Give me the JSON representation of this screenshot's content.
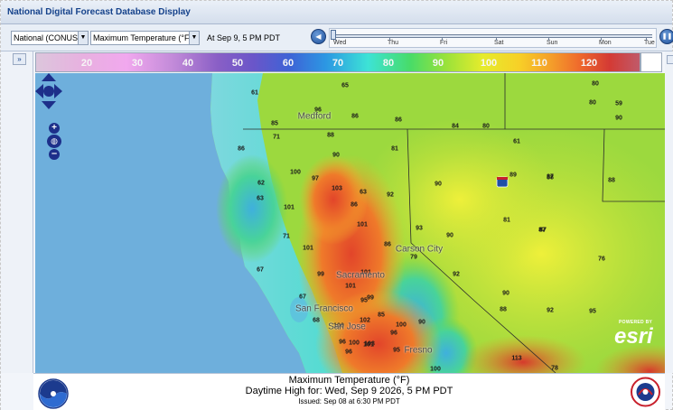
{
  "window": {
    "title": "National Digital Forecast Database Display"
  },
  "toolbar": {
    "region_select": "National (CONUS",
    "element_select": "Maximum Temperature (°F",
    "valid_time": "At Sep  9,   5 PM PDT",
    "timeline_days": [
      "Wed",
      "Thu",
      "Fri",
      "Sat",
      "Sun",
      "Mon",
      "Tue"
    ]
  },
  "legend": {
    "labels": [
      "20",
      "30",
      "40",
      "50",
      "60",
      "70",
      "80",
      "90",
      "100",
      "110",
      "120"
    ]
  },
  "map": {
    "cities": [
      "Medford",
      "Carson City",
      "Sacramento",
      "San Francisco",
      "San Jose",
      "Fresno"
    ],
    "temps": [
      "61",
      "65",
      "85",
      "96",
      "86",
      "86",
      "84",
      "80",
      "80",
      "80",
      "59",
      "90",
      "71",
      "88",
      "81",
      "61",
      "86",
      "90",
      "89",
      "87",
      "100",
      "97",
      "90",
      "88",
      "62",
      "63",
      "103",
      "63",
      "92",
      "88",
      "101",
      "86",
      "101",
      "93",
      "90",
      "87",
      "71",
      "101",
      "86",
      "81",
      "87",
      "76",
      "79",
      "67",
      "99",
      "101",
      "92",
      "101",
      "95",
      "67",
      "99",
      "90",
      "88",
      "92",
      "95",
      "68",
      "100",
      "102",
      "96",
      "85",
      "90",
      "96",
      "100",
      "96",
      "103",
      "100",
      "113",
      "101",
      "95",
      "78",
      "100"
    ],
    "attribution_small": "POWERED BY",
    "attribution_brand": "esri"
  },
  "footer": {
    "title": "Maximum Temperature (°F)",
    "daytime": "Daytime High for: Wed, Sep   9 2026,   5 PM PDT",
    "issued": "Issued: Sep 08 at 6:30 PM PDT"
  },
  "colors": {
    "title_text": "#15428b",
    "ocean": "#6eafdc",
    "nav_blue": "#1d2f8a"
  }
}
